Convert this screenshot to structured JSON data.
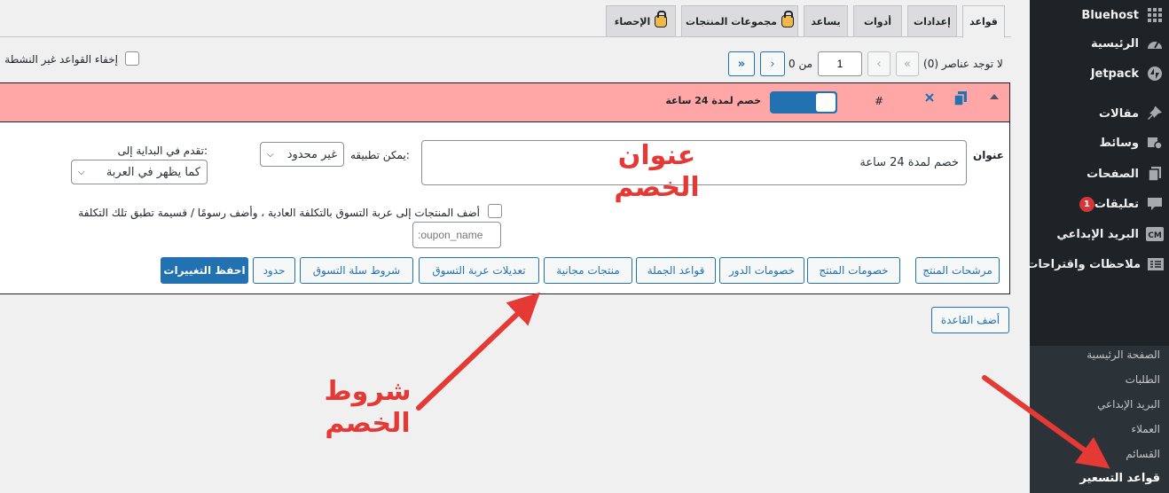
{
  "tabs": [
    {
      "label": "قواعد",
      "active": true
    },
    {
      "label": "إعدادات",
      "active": false
    },
    {
      "label": "أدوات",
      "active": false
    },
    {
      "label": "يساعد",
      "active": false
    },
    {
      "label": "مجموعات المنتجات",
      "locked": true
    },
    {
      "label": "الإحصاء",
      "locked": true
    }
  ],
  "filters": {
    "hide_inactive_label": "إخفاء القواعد غير النشطة"
  },
  "pagination": {
    "no_items_label": "لا توجد عناصر (0)",
    "first": "«",
    "prev": "‹",
    "current_page": "1",
    "of_label": "من 0",
    "next": "›",
    "last": "»"
  },
  "rule": {
    "header_title": "خصم لمدة 24 ساعة",
    "hash": "#",
    "title_label": "عنوان",
    "title_value": "خصم لمدة 24 ساعة",
    "apply_label": "يمكن تطبيقه:",
    "apply_value": "غير محدود",
    "advance_label": "تقدم في البداية إلى:",
    "advance_value": "كما يظهر في العربة",
    "add_products_label": "أضف المنتجات إلى عربة التسوق بالتكلفة العادية ، وأضف رسومًا / قسيمة تطبق تلك التكلفة",
    "coupon_placeholder": ":oupon_name",
    "buttons": {
      "product_filters": "مرشحات المنتج",
      "product_discounts": "خصومات المنتج",
      "role_discounts": "خصومات الدور",
      "bulk_rules": "قواعد الجملة",
      "free_products": "منتجات مجانية",
      "cart_adjustments": "تعديلات عربة التسوق",
      "cart_conditions": "شروط سلة التسوق",
      "limits": "حدود",
      "save": "احفظ التغييرات"
    }
  },
  "add_rule_label": "أضف القاعدة",
  "annotations": {
    "title_note": "عنوان الخصم",
    "conditions_note": "شروط الخصم"
  },
  "sidebar": {
    "items": [
      {
        "label": "Bluehost",
        "icon": "grid-icon"
      },
      {
        "label": "الرئيسية",
        "icon": "dashboard-icon"
      },
      {
        "label": "Jetpack",
        "icon": "jetpack-icon"
      },
      {
        "label": "مقالات",
        "icon": "pin-icon"
      },
      {
        "label": "وسائط",
        "icon": "media-icon"
      },
      {
        "label": "الصفحات",
        "icon": "pages-icon"
      },
      {
        "label": "تعليقات",
        "icon": "comments-icon",
        "badge": "1"
      },
      {
        "label": "البريد الإبداعي",
        "icon": "cm-icon"
      },
      {
        "label": "ملاحظات واقتراحات",
        "icon": "feedback-icon"
      }
    ],
    "submenu": [
      {
        "label": "الصفحة الرئيسية"
      },
      {
        "label": "الطلبات"
      },
      {
        "label": "البريد الإبداعي"
      },
      {
        "label": "العملاء"
      },
      {
        "label": "القسائم"
      },
      {
        "label": "قواعد التسعير",
        "active": true
      }
    ]
  },
  "colors": {
    "accent": "#2271b1",
    "header_bg": "#ffa6a6",
    "annotation": "#e53935",
    "sidebar": "#1d2327"
  }
}
